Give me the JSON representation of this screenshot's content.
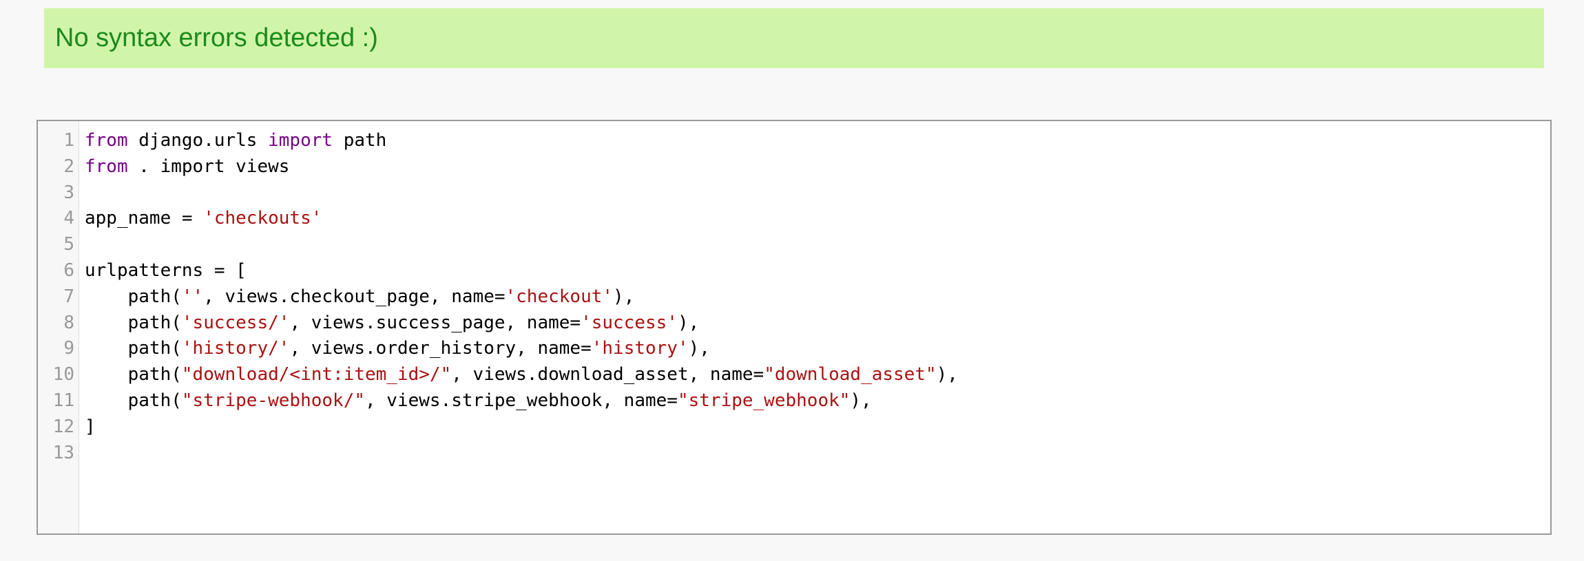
{
  "status": {
    "message": "No syntax errors detected :)",
    "color": "#1b8a1b",
    "background": "#d0f5a9"
  },
  "editor": {
    "lines": [
      {
        "number": "1",
        "tokens": [
          {
            "t": "from",
            "k": "keyword"
          },
          {
            "t": " django.urls ",
            "k": "plain"
          },
          {
            "t": "import",
            "k": "keyword"
          },
          {
            "t": " path",
            "k": "plain"
          }
        ]
      },
      {
        "number": "2",
        "tokens": [
          {
            "t": "from",
            "k": "keyword"
          },
          {
            "t": " . import views",
            "k": "plain"
          }
        ]
      },
      {
        "number": "3",
        "tokens": []
      },
      {
        "number": "4",
        "tokens": [
          {
            "t": "app_name = ",
            "k": "plain"
          },
          {
            "t": "'checkouts'",
            "k": "string"
          }
        ]
      },
      {
        "number": "5",
        "tokens": []
      },
      {
        "number": "6",
        "tokens": [
          {
            "t": "urlpatterns = [",
            "k": "plain"
          }
        ]
      },
      {
        "number": "7",
        "tokens": [
          {
            "t": "    path(",
            "k": "plain"
          },
          {
            "t": "''",
            "k": "string"
          },
          {
            "t": ", views.checkout_page, name=",
            "k": "plain"
          },
          {
            "t": "'checkout'",
            "k": "string"
          },
          {
            "t": "),",
            "k": "plain"
          }
        ]
      },
      {
        "number": "8",
        "tokens": [
          {
            "t": "    path(",
            "k": "plain"
          },
          {
            "t": "'success/'",
            "k": "string"
          },
          {
            "t": ", views.success_page, name=",
            "k": "plain"
          },
          {
            "t": "'success'",
            "k": "string"
          },
          {
            "t": "),",
            "k": "plain"
          }
        ]
      },
      {
        "number": "9",
        "tokens": [
          {
            "t": "    path(",
            "k": "plain"
          },
          {
            "t": "'history/'",
            "k": "string"
          },
          {
            "t": ", views.order_history, name=",
            "k": "plain"
          },
          {
            "t": "'history'",
            "k": "string"
          },
          {
            "t": "),",
            "k": "plain"
          }
        ]
      },
      {
        "number": "10",
        "tokens": [
          {
            "t": "    path(",
            "k": "plain"
          },
          {
            "t": "\"download/<int:item_id>/\"",
            "k": "string"
          },
          {
            "t": ", views.download_asset, name=",
            "k": "plain"
          },
          {
            "t": "\"download_asset\"",
            "k": "string"
          },
          {
            "t": "),",
            "k": "plain"
          }
        ]
      },
      {
        "number": "11",
        "tokens": [
          {
            "t": "    path(",
            "k": "plain"
          },
          {
            "t": "\"stripe-webhook/\"",
            "k": "string"
          },
          {
            "t": ", views.stripe_webhook, name=",
            "k": "plain"
          },
          {
            "t": "\"stripe_webhook\"",
            "k": "string"
          },
          {
            "t": "),",
            "k": "plain"
          }
        ]
      },
      {
        "number": "12",
        "tokens": [
          {
            "t": "]",
            "k": "plain"
          }
        ]
      },
      {
        "number": "13",
        "tokens": []
      }
    ]
  }
}
